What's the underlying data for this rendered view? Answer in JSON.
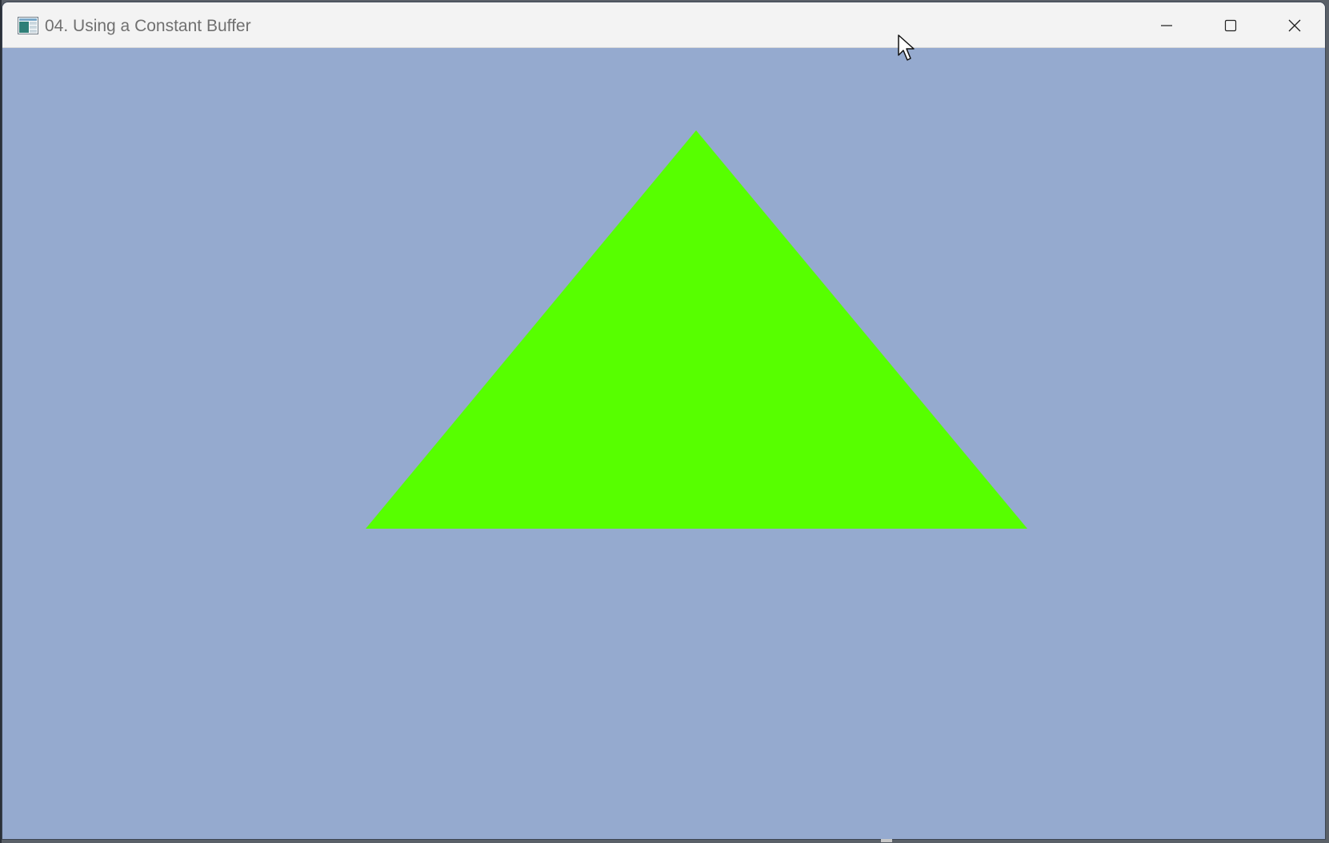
{
  "window": {
    "title": "04. Using a Constant Buffer",
    "app_icon": "application-window-icon",
    "controls": {
      "minimize_icon": "minimize-icon",
      "maximize_icon": "maximize-icon",
      "close_icon": "close-icon"
    }
  },
  "viewport": {
    "clear_color": "#95aacf",
    "triangle_color": "#57ff00"
  },
  "cursor": {
    "icon": "arrow-cursor-icon"
  }
}
